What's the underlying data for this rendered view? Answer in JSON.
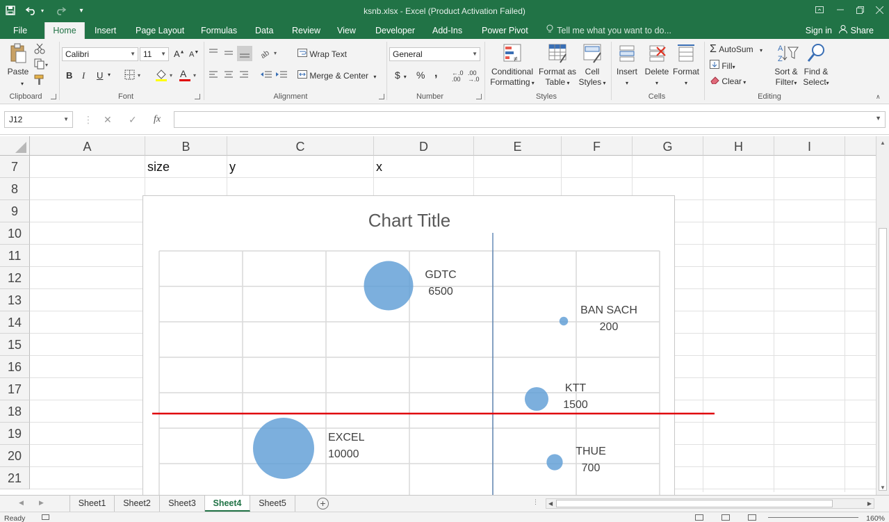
{
  "titlebar": {
    "title": "ksnb.xlsx - Excel (Product Activation Failed)"
  },
  "tabs": [
    "File",
    "Home",
    "Insert",
    "Page Layout",
    "Formulas",
    "Data",
    "Review",
    "View",
    "Developer",
    "Add-Ins",
    "Power Pivot"
  ],
  "tell_me": "Tell me what you want to do...",
  "sign_in": "Sign in",
  "share": "Share",
  "ribbon": {
    "clipboard": {
      "label": "Clipboard",
      "paste": "Paste"
    },
    "font": {
      "label": "Font",
      "font_name": "Calibri",
      "font_size": "11",
      "bold": "B",
      "italic": "I",
      "underline": "U"
    },
    "alignment": {
      "label": "Alignment",
      "wrap_text": "Wrap Text",
      "merge_center": "Merge & Center"
    },
    "number": {
      "label": "Number",
      "format": "General",
      "currency": "$",
      "percent": "%",
      "comma": ",",
      "inc_decimal": "←.0 .00",
      "dec_decimal": ".00 →.0"
    },
    "styles": {
      "label": "Styles",
      "conditional": "Conditional",
      "formatting": "Formatting",
      "format_as": "Format as",
      "table": "Table",
      "cell": "Cell",
      "styles_btn": "Styles"
    },
    "cells": {
      "label": "Cells",
      "insert": "Insert",
      "delete": "Delete",
      "format": "Format"
    },
    "editing": {
      "label": "Editing",
      "autosum": "AutoSum",
      "fill": "Fill",
      "clear": "Clear",
      "sort_filter": "Sort &",
      "filter": "Filter",
      "find_select": "Find &",
      "select": "Select"
    }
  },
  "formula_bar": {
    "name_box": "J12",
    "fx": "fx",
    "value": ""
  },
  "columns": [
    "A",
    "B",
    "C",
    "D",
    "E",
    "F",
    "G",
    "H",
    "I"
  ],
  "rows": [
    "7",
    "8",
    "9",
    "10",
    "11",
    "12",
    "13",
    "14",
    "15",
    "16",
    "17",
    "18",
    "19",
    "20",
    "21"
  ],
  "cells": {
    "B7": "size",
    "C7": "y",
    "D7": "x"
  },
  "chart_data": {
    "type": "scatter",
    "title": "Chart Title",
    "points": [
      {
        "label": "GDTC",
        "size": 6500
      },
      {
        "label": "BAN SACH",
        "size": 200
      },
      {
        "label": "KTT",
        "size": 1500
      },
      {
        "label": "EXCEL",
        "size": 10000
      },
      {
        "label": "THUE",
        "size": 700
      }
    ],
    "bubble_color": "#5b9bd5",
    "grid": true,
    "legend": "none"
  },
  "sheets": [
    "Sheet1",
    "Sheet2",
    "Sheet3",
    "Sheet4",
    "Sheet5"
  ],
  "active_sheet": "Sheet4",
  "status": {
    "ready": "Ready",
    "zoom": "160%"
  },
  "colors": {
    "excel_green": "#217346",
    "bubble": "#5b9bd5",
    "red_line": "#e0000d",
    "blue_line": "#3f6fa5"
  }
}
